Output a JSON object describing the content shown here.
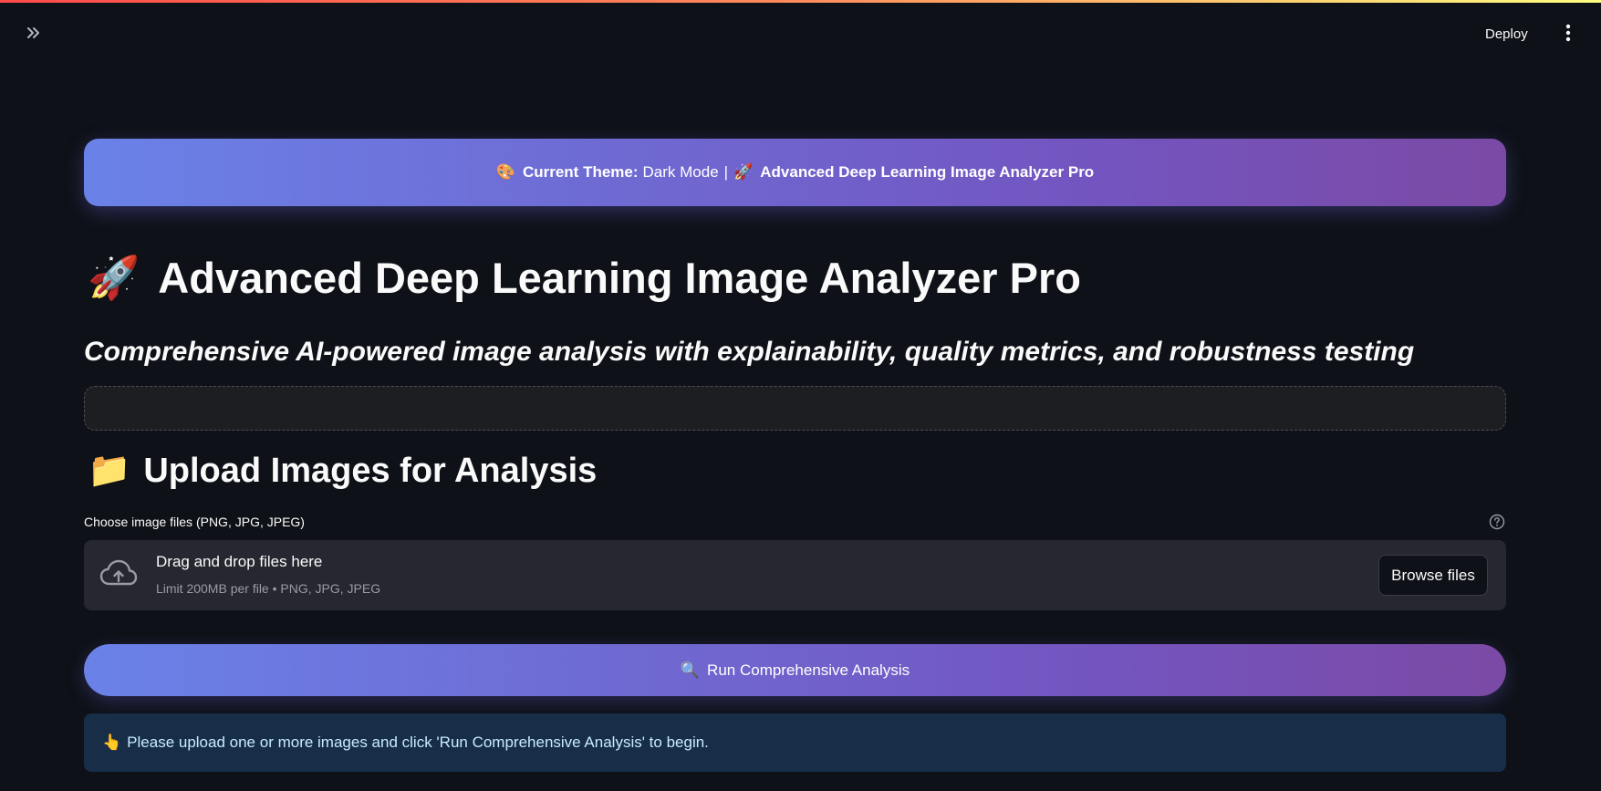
{
  "header": {
    "deploy_label": "Deploy",
    "sidebar_toggle_icon": "double-chevron-right-icon",
    "menu_icon": "vertical-dots-icon"
  },
  "theme_banner": {
    "palette_emoji": "🎨",
    "prefix": "Current Theme:",
    "mode": "Dark Mode",
    "separator": "|",
    "rocket_emoji": "🚀",
    "app_name": "Advanced Deep Learning Image Analyzer Pro"
  },
  "page": {
    "title_emoji": "🚀",
    "title": "Advanced Deep Learning Image Analyzer Pro",
    "subtitle": "Comprehensive AI-powered image analysis with explainability, quality metrics, and robustness testing"
  },
  "upload_section": {
    "heading_emoji": "📁",
    "heading": "Upload Images for Analysis",
    "uploader_label": "Choose image files (PNG, JPG, JPEG)",
    "drop_title": "Drag and drop files here",
    "drop_limit": "Limit 200MB per file • PNG, JPG, JPEG",
    "browse_label": "Browse files"
  },
  "run_button": {
    "emoji": "🔍",
    "label": "Run Comprehensive Analysis"
  },
  "info": {
    "emoji": "👆",
    "message": "Please upload one or more images and click 'Run Comprehensive Analysis' to begin."
  },
  "colors": {
    "background": "#0e1117",
    "gradient_start": "#6a82e8",
    "gradient_end": "#7b4aa5",
    "dropzone": "#262730",
    "info_bg": "#172d48",
    "info_text": "#c7ebff"
  }
}
